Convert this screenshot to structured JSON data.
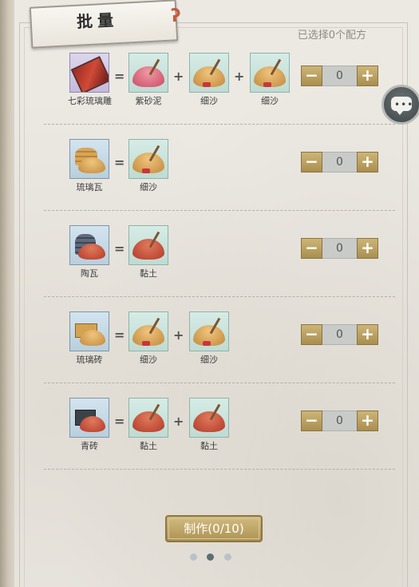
{
  "header": {
    "tab_title": "批量",
    "selected_text": "已选择0个配方"
  },
  "operators": {
    "equals": "=",
    "plus": "+"
  },
  "recipes": [
    {
      "result": "七彩琉璃雕",
      "ingredients": [
        "紫砂泥",
        "细沙",
        "细沙"
      ],
      "quantity": "0"
    },
    {
      "result": "琉璃瓦",
      "ingredients": [
        "细沙"
      ],
      "quantity": "0"
    },
    {
      "result": "陶瓦",
      "ingredients": [
        "黏土"
      ],
      "quantity": "0"
    },
    {
      "result": "琉璃砖",
      "ingredients": [
        "细沙",
        "细沙"
      ],
      "quantity": "0"
    },
    {
      "result": "青砖",
      "ingredients": [
        "黏土",
        "黏土"
      ],
      "quantity": "0"
    }
  ],
  "stepper": {
    "minus": "−",
    "plus": "+"
  },
  "make_button": "制作(0/10)",
  "pager": {
    "page_count": 3,
    "current": 2
  },
  "icons": {
    "chat": "chat-bubble-icon",
    "ribbon": "ribbon-icon"
  },
  "colors": {
    "button_gold": "#b9a060",
    "panel_bg": "#ece9e3",
    "page_dot_active": "#5f6e71"
  }
}
